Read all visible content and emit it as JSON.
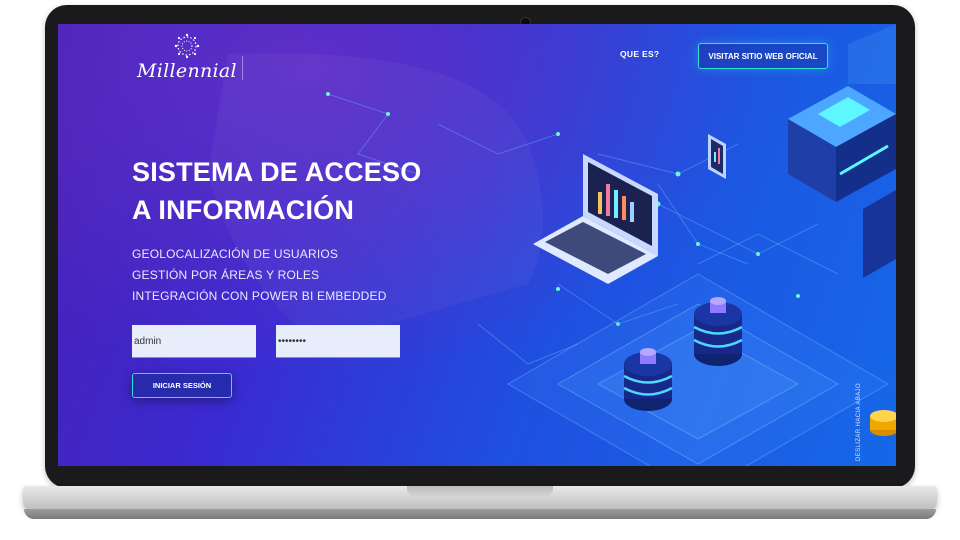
{
  "brand": {
    "name": "Millennial",
    "icon": "circle-dots-logo"
  },
  "nav": {
    "link": "QUE ES?",
    "cta": "VISITAR SITIO WEB OFICIAL"
  },
  "hero": {
    "title_line1": "SISTEMA DE ACCESO",
    "title_line2": "A INFORMACIÓN",
    "features": [
      "GEOLOCALIZACIÓN DE USUARIOS",
      "GESTIÓN POR ÁREAS Y ROLES",
      "INTEGRACIÓN CON POWER BI EMBEDDED"
    ]
  },
  "login": {
    "username_value": "admin",
    "password_value": "••••••••",
    "submit_label": "INICIAR SESIÓN"
  },
  "scroll_hint": "DESLIZAR HACIA ABAJO",
  "colors": {
    "accent": "#2fe0d8",
    "bg_start": "#4a1fb3",
    "bg_end": "#1668e8",
    "input_bg": "#e8edfb"
  }
}
